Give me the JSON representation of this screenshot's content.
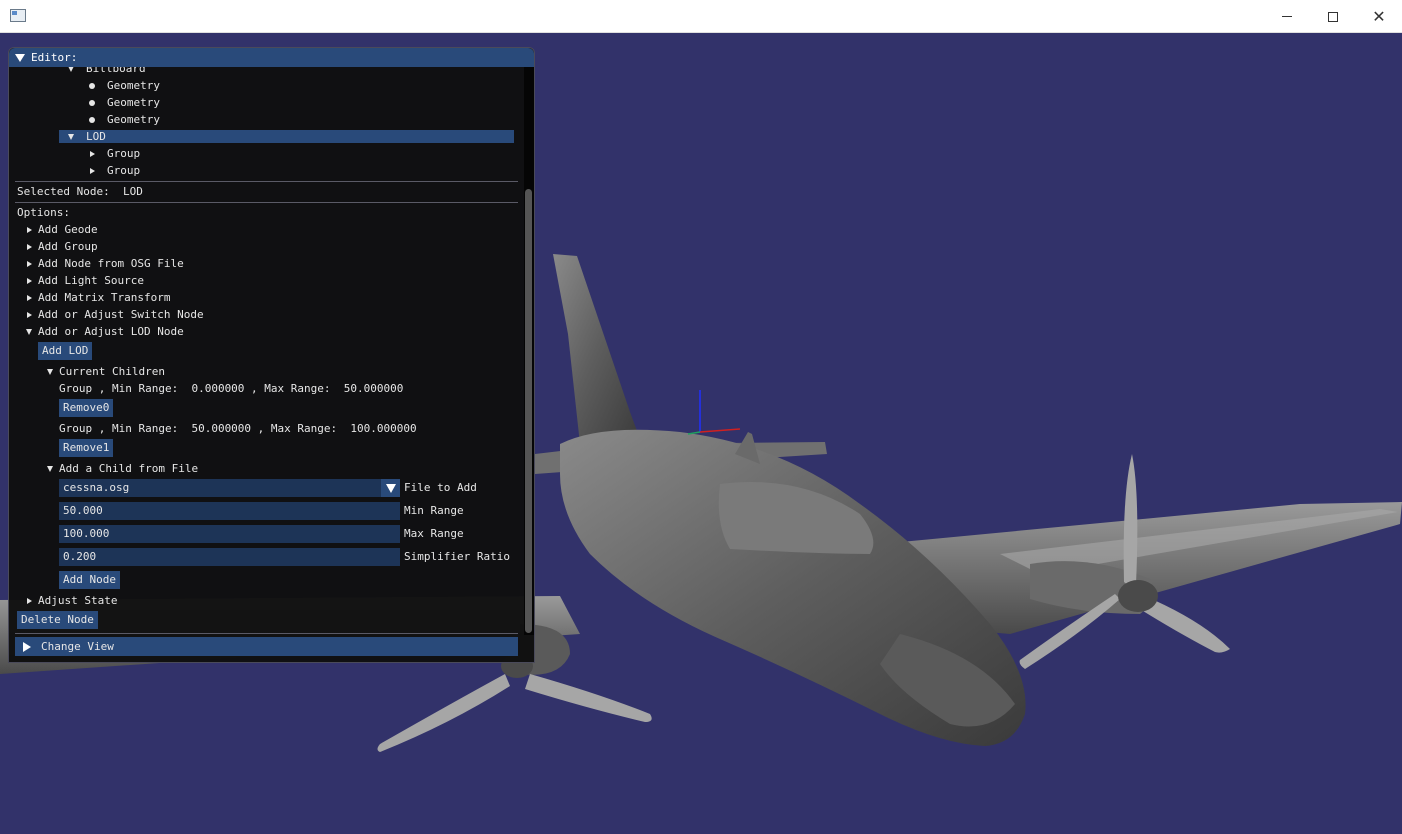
{
  "window": {
    "app_icon": "window-app-icon",
    "controls": {
      "minimize": "—",
      "maximize": "☐",
      "close": "✕"
    }
  },
  "scene": {
    "background": "#32326a",
    "model_color": "#6b6b6b"
  },
  "editor": {
    "title": "Editor:",
    "tree": [
      {
        "label": "Billboard",
        "icon": "chevron-down-icon"
      },
      {
        "label": "Geometry",
        "icon": "bullet-icon"
      },
      {
        "label": "Geometry",
        "icon": "bullet-icon"
      },
      {
        "label": "Geometry",
        "icon": "bullet-icon"
      },
      {
        "label": "LOD",
        "icon": "chevron-down-icon",
        "selected": true
      },
      {
        "label": "Group",
        "icon": "chevron-right-icon"
      },
      {
        "label": "Group",
        "icon": "chevron-right-icon"
      }
    ],
    "selected_node_text": "Selected Node:  LOD",
    "options_label": "Options:",
    "options": [
      {
        "label": "Add Geode",
        "expanded": false
      },
      {
        "label": "Add Group",
        "expanded": false
      },
      {
        "label": "Add Node from OSG File",
        "expanded": false
      },
      {
        "label": "Add Light Source",
        "expanded": false
      },
      {
        "label": "Add Matrix Transform",
        "expanded": false
      },
      {
        "label": "Add or Adjust Switch Node",
        "expanded": false
      },
      {
        "label": "Add or Adjust LOD Node",
        "expanded": true
      }
    ],
    "lod": {
      "add_lod_label": "Add LOD",
      "current_children_label": "Current Children",
      "children": [
        {
          "text": "Group , Min Range:  0.000000 , Max Range:  50.000000",
          "remove_label": "Remove0"
        },
        {
          "text": "Group , Min Range:  50.000000 , Max Range:  100.000000",
          "remove_label": "Remove1"
        }
      ],
      "add_child_label": "Add a Child from File",
      "file_value": "cessna.osg",
      "file_label": "File to Add",
      "min_value": "50.000",
      "min_label": "Min Range",
      "max_value": "100.000",
      "max_label": "Max Range",
      "simp_value": "0.200",
      "simp_label": "Simplifier Ratio",
      "add_node_label": "Add Node"
    },
    "adjust_state_label": "Adjust State",
    "delete_node_label": "Delete Node",
    "change_view_label": "Change View"
  }
}
